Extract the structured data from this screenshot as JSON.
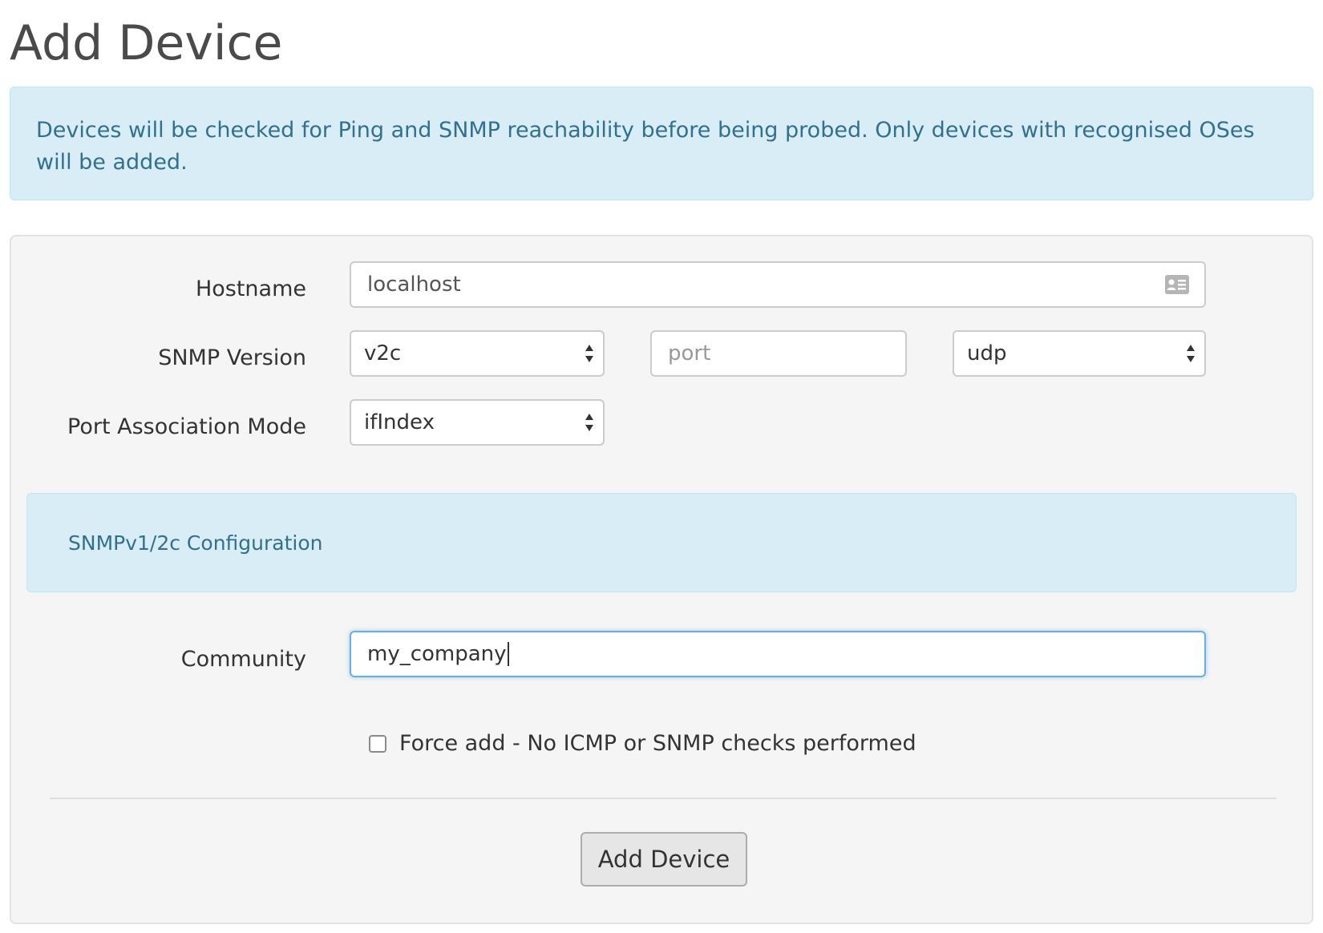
{
  "page": {
    "title": "Add Device"
  },
  "info_alert": {
    "text": "Devices will be checked for Ping and SNMP reachability before being probed. Only devices with recognised OSes will be added."
  },
  "form": {
    "hostname": {
      "label": "Hostname",
      "value": "localhost",
      "icon": "contact-card-icon"
    },
    "snmp_version": {
      "label": "SNMP Version",
      "value": "v2c",
      "port_placeholder": "port",
      "transport": "udp"
    },
    "port_association": {
      "label": "Port Association Mode",
      "value": "ifIndex"
    },
    "snmp_config_panel": {
      "title": "SNMPv1/2c Configuration"
    },
    "community": {
      "label": "Community",
      "value": "my_company"
    },
    "force_add": {
      "label": "Force add - No ICMP or SNMP checks performed",
      "checked": false
    },
    "submit_label": "Add Device"
  },
  "colors": {
    "info_bg": "#d9edf7",
    "info_text": "#31708f",
    "focus_border": "#66afe9"
  }
}
